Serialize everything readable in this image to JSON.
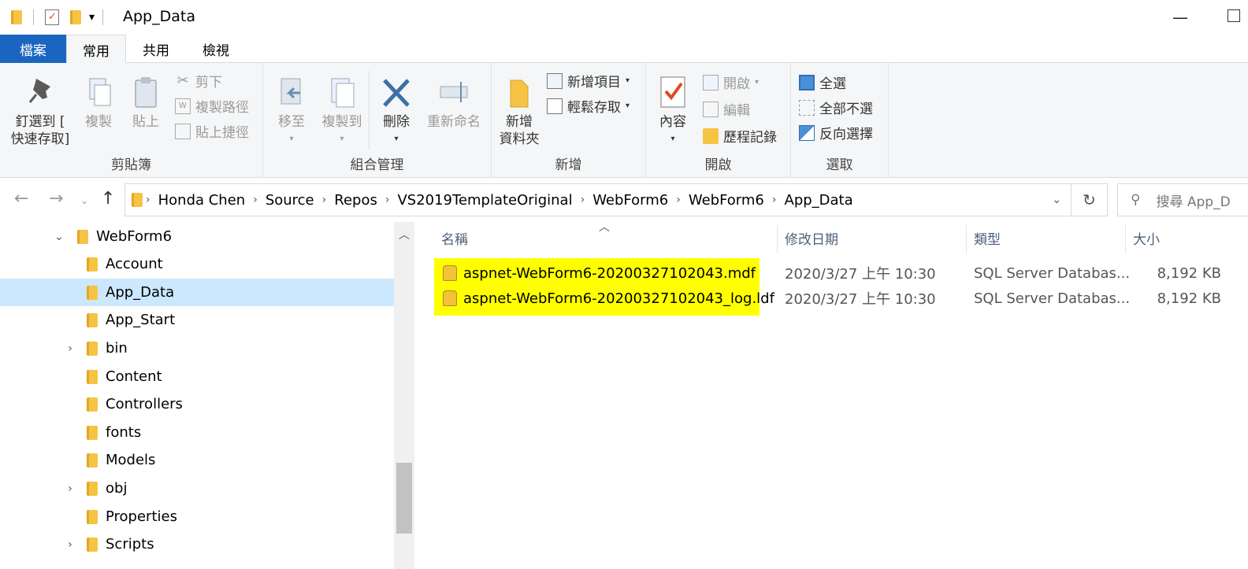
{
  "window": {
    "title": "App_Data",
    "quick_access_dropdown": "▾"
  },
  "ribbon_tabs": [
    {
      "label": "檔案"
    },
    {
      "label": "常用"
    },
    {
      "label": "共用"
    },
    {
      "label": "檢視"
    }
  ],
  "clipboard": {
    "pin_label_1": "釘選到 [",
    "pin_label_2": "快速存取]",
    "copy_label": "複製",
    "paste_label": "貼上",
    "cut_label": "剪下",
    "copy_path_label": "複製路徑",
    "paste_shortcut_label": "貼上捷徑",
    "group_label": "剪貼簿"
  },
  "organize": {
    "move_to_label": "移至",
    "copy_to_label": "複製到",
    "delete_label": "刪除",
    "rename_label": "重新命名",
    "group_label": "組合管理"
  },
  "new": {
    "new_folder_label_1": "新增",
    "new_folder_label_2": "資料夾",
    "new_item_label": "新增項目",
    "easy_access_label": "輕鬆存取",
    "group_label": "新增"
  },
  "open": {
    "properties_label": "內容",
    "open_label": "開啟",
    "edit_label": "編輯",
    "history_label": "歷程記錄",
    "group_label": "開啟"
  },
  "select": {
    "select_all_label": "全選",
    "select_none_label": "全部不選",
    "invert_label": "反向選擇",
    "group_label": "選取"
  },
  "address": {
    "breadcrumbs": [
      "Honda Chen",
      "Source",
      "Repos",
      "VS2019TemplateOriginal",
      "WebForm6",
      "WebForm6",
      "App_Data"
    ]
  },
  "search": {
    "placeholder": "搜尋 App_D"
  },
  "tree": {
    "root": "WebForm6",
    "items": [
      {
        "label": "Account"
      },
      {
        "label": "App_Data"
      },
      {
        "label": "App_Start"
      },
      {
        "label": "bin"
      },
      {
        "label": "Content"
      },
      {
        "label": "Controllers"
      },
      {
        "label": "fonts"
      },
      {
        "label": "Models"
      },
      {
        "label": "obj"
      },
      {
        "label": "Properties"
      },
      {
        "label": "Scripts"
      }
    ]
  },
  "columns": {
    "name": "名稱",
    "date": "修改日期",
    "type": "類型",
    "size": "大小"
  },
  "files": [
    {
      "name": "aspnet-WebForm6-20200327102043.mdf",
      "date": "2020/3/27 上午 10:30",
      "type": "SQL Server Databas...",
      "size": "8,192 KB"
    },
    {
      "name": "aspnet-WebForm6-20200327102043_log.ldf",
      "date": "2020/3/27 上午 10:30",
      "type": "SQL Server Databas...",
      "size": "8,192 KB"
    }
  ],
  "colors": {
    "file_tab": "#1a65c0",
    "selection": "#cce8ff",
    "highlight": "#ffff00",
    "folder": "#f6c445"
  }
}
